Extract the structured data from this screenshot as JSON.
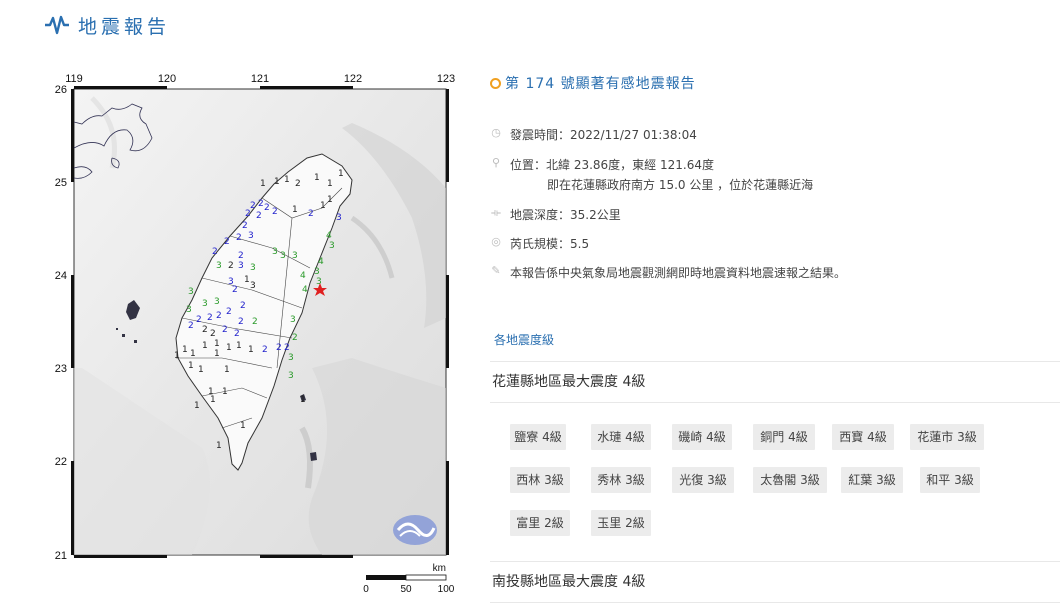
{
  "header": {
    "title": "地震報告",
    "icon": "earthquake-wave-icon"
  },
  "map": {
    "x_ticks": [
      "119",
      "120",
      "121",
      "122",
      "123"
    ],
    "y_ticks": [
      "26",
      "25",
      "24",
      "23",
      "22",
      "21"
    ],
    "scale_unit": "km",
    "scale_ticks": [
      "0",
      "50",
      "100"
    ],
    "epicenter_marker": "red-star-icon",
    "logo": "cwb-logo-icon"
  },
  "report": {
    "title": "第 174 號顯著有感地震報告",
    "time_label": "發震時間：2022/11/27 01:38:04",
    "location_label": "位置：北緯 23.86度，東經 121.64度",
    "location_sub": "即在花蓮縣政府南方 15.0 公里 ，位於花蓮縣近海",
    "depth_label": "地震深度：35.2公里",
    "magnitude_label": "芮氏規模：5.5",
    "note": "本報告係中央氣象局地震觀測網即時地震資料地震速報之結果。"
  },
  "intensity": {
    "section_label": "各地震度級",
    "counties": [
      {
        "title": "花蓮縣地區最大震度 4級",
        "stations": [
          "鹽寮 4級",
          "水璉 4級",
          "磯崎 4級",
          "銅門 4級",
          "西寶 4級",
          "花蓮市 3級",
          "西林 3級",
          "秀林 3級",
          "光復 3級",
          "太魯閣 3級",
          "紅葉 3級",
          "和平 3級",
          "富里 2級",
          "玉里 2級"
        ]
      },
      {
        "title": "南投縣地區最大震度 4級",
        "stations": []
      }
    ]
  },
  "colors": {
    "accent": "#2a6fb0",
    "title_dot": "#f0a020",
    "level1": "#222222",
    "level2": "#2222cc",
    "level3": "#2a9a2a",
    "epicenter": "#e02020"
  }
}
